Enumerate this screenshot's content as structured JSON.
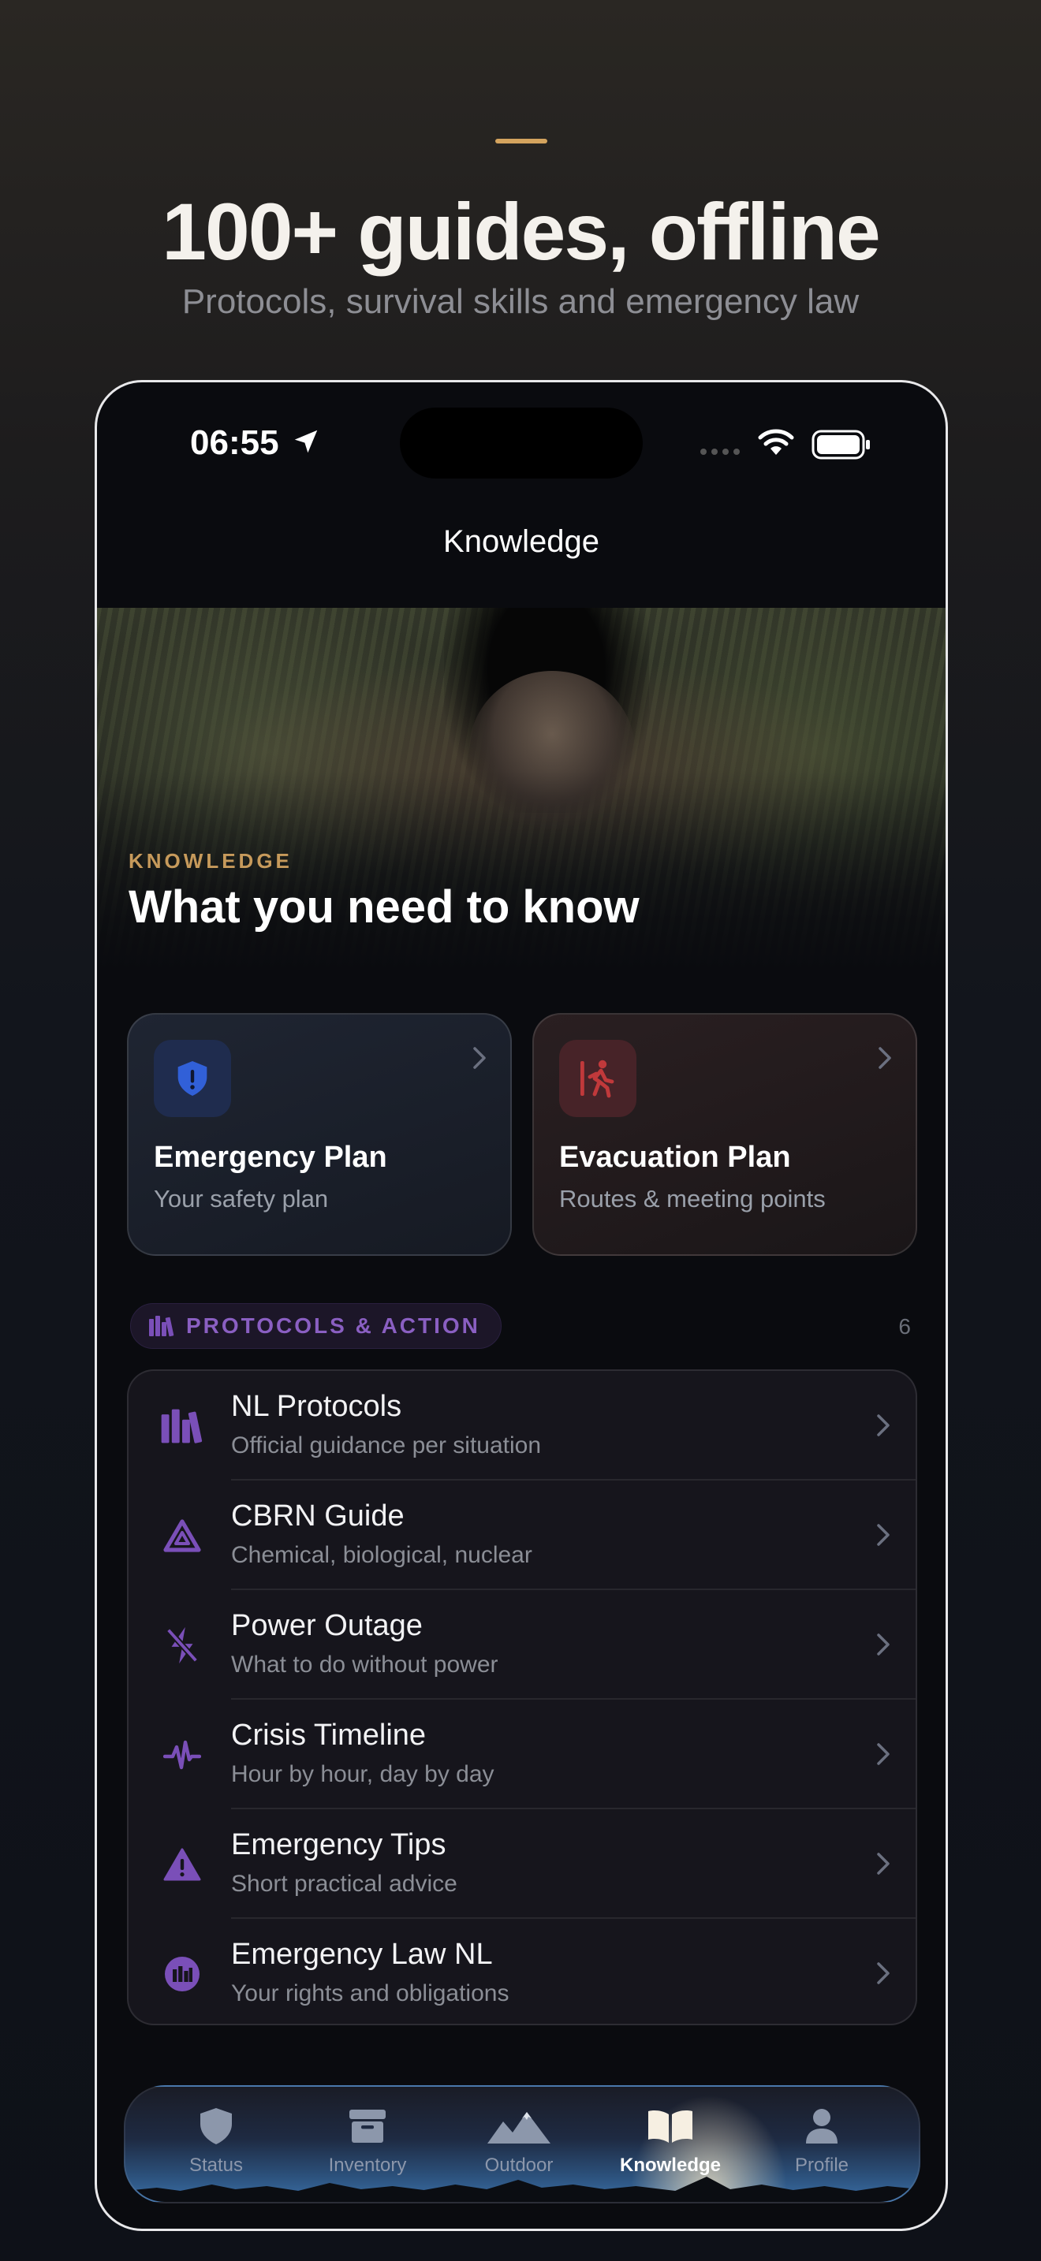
{
  "promo": {
    "headline": "100+ guides, offline",
    "subhead": "Protocols, survival skills and emergency law"
  },
  "status_bar": {
    "time": "06:55"
  },
  "nav": {
    "title": "Knowledge"
  },
  "hero": {
    "kicker": "KNOWLEDGE",
    "title": "What you need to know"
  },
  "plans": [
    {
      "title": "Emergency Plan",
      "subtitle": "Your safety plan",
      "icon": "shield-exclamation-icon",
      "color": "#2f5bd3"
    },
    {
      "title": "Evacuation Plan",
      "subtitle": "Routes & meeting points",
      "icon": "person-exit-icon",
      "color": "#c0393b"
    }
  ],
  "section": {
    "label": "PROTOCOLS & ACTION",
    "count": "6",
    "accent": "#7a4fb8"
  },
  "items": [
    {
      "title": "NL Protocols",
      "subtitle": "Official guidance per situation",
      "icon": "books-icon"
    },
    {
      "title": "CBRN Guide",
      "subtitle": "Chemical, biological, nuclear",
      "icon": "triangle-hazard-icon"
    },
    {
      "title": "Power Outage",
      "subtitle": "What to do without power",
      "icon": "bolt-slash-icon"
    },
    {
      "title": "Crisis Timeline",
      "subtitle": "Hour by hour, day by day",
      "icon": "waveform-icon"
    },
    {
      "title": "Emergency Tips",
      "subtitle": "Short practical advice",
      "icon": "warning-triangle-icon"
    },
    {
      "title": "Emergency Law NL",
      "subtitle": "Your rights and obligations",
      "icon": "law-books-circle-icon"
    }
  ],
  "tabs": [
    {
      "label": "Status",
      "icon": "shield-icon",
      "active": false
    },
    {
      "label": "Inventory",
      "icon": "archive-box-icon",
      "active": false
    },
    {
      "label": "Outdoor",
      "icon": "mountains-icon",
      "active": false
    },
    {
      "label": "Knowledge",
      "icon": "open-book-icon",
      "active": true
    },
    {
      "label": "Profile",
      "icon": "person-icon",
      "active": false
    }
  ]
}
